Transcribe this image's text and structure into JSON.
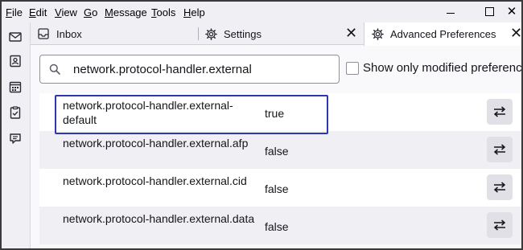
{
  "menubar": {
    "items": [
      {
        "underline": "F",
        "rest": "ile"
      },
      {
        "underline": "E",
        "rest": "dit"
      },
      {
        "underline": "V",
        "rest": "iew"
      },
      {
        "underline": "G",
        "rest": "o"
      },
      {
        "underline": "M",
        "rest": "essage"
      },
      {
        "underline": "T",
        "rest": "ools"
      },
      {
        "underline": "H",
        "rest": "elp"
      }
    ]
  },
  "window": {
    "close_glyph": "✕"
  },
  "spaces": {
    "icons": [
      "mail-icon",
      "address-book-icon",
      "calendar-icon",
      "tasks-icon",
      "chat-icon"
    ]
  },
  "tabs": [
    {
      "label": "Inbox",
      "icon": "inbox-icon"
    },
    {
      "label": "Settings",
      "icon": "gear-icon",
      "close": "✕"
    },
    {
      "label": "Advanced Preferences",
      "icon": "gear-icon",
      "close": "✕"
    }
  ],
  "search": {
    "value": "network.protocol-handler.external"
  },
  "filter": {
    "label": "Show only modified preferences"
  },
  "prefs": [
    {
      "name": "network.protocol-handler.external-default",
      "value": "true"
    },
    {
      "name": "network.protocol-handler.external.afp",
      "value": "false"
    },
    {
      "name": "network.protocol-handler.external.cid",
      "value": "false"
    },
    {
      "name": "network.protocol-handler.external.data",
      "value": "false"
    }
  ],
  "colors": {
    "highlight": "#2b38b0",
    "row_alt": "#f0f0f4"
  }
}
